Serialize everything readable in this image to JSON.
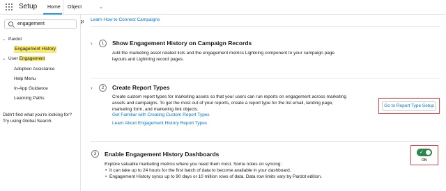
{
  "header": {
    "app_title": "Setup",
    "tabs": [
      "Home",
      "Object Manager"
    ],
    "app_launcher_icon": "grid-icon"
  },
  "sidebar": {
    "search_value": "engagement",
    "tree": [
      {
        "label": "Pardot",
        "level": 0,
        "expanded": true
      },
      {
        "label": "Engagement History",
        "level": 1,
        "highlight": true
      },
      {
        "label_prefix": "User ",
        "label_hl": "Engagement",
        "level": 0,
        "expanded": true
      },
      {
        "label": "Adoption Assistance",
        "level": 1
      },
      {
        "label": "Help Menu",
        "level": 1
      },
      {
        "label": "In-App Guidance",
        "level": 1
      },
      {
        "label": "Learning Paths",
        "level": 1
      }
    ],
    "help_text_line1": "Didn't find what you're looking for?",
    "help_text_line2": "Try using Global Search."
  },
  "main": {
    "top_link": "Learn How to Connect Campaigns",
    "steps": [
      {
        "number": "1",
        "title": "Show Engagement History on Campaign Records",
        "description": "Add the marketing asset related lists and the engagement metrics Lightning component to your campaign page layouts and Lightning record pages."
      },
      {
        "number": "2",
        "title": "Create Report Types",
        "description": "Create custom report types for marketing assets so that your users can run reports on engagement across marketing assets and campaigns. To get the most out of your reports, create a report type for the list email, landing page, marketing form, and marketing link objects.",
        "links": [
          "Get Familiar with Creating Custom Report Types",
          "Learn About Engagement History Report Types"
        ],
        "button_label": "Go to Report Type Setup"
      },
      {
        "number": "3",
        "title": "Enable Engagement History Dashboards",
        "description": "Explore valuable marketing metrics where you need them most. Some notes on syncing:",
        "bullets": [
          "It can take up to 24 hours for the first batch of data to become available in your dashboard.",
          "Engagement History syncs up to 90 days or 10 million rows of data. Data row limits vary by Pardot edition."
        ],
        "toggle_label": "ON",
        "toggle_on": true
      }
    ]
  },
  "colors": {
    "link": "#0176d3",
    "highlight": "#f8e86f",
    "annotation_red": "#e4484f",
    "toggle_green": "#2e844a"
  }
}
